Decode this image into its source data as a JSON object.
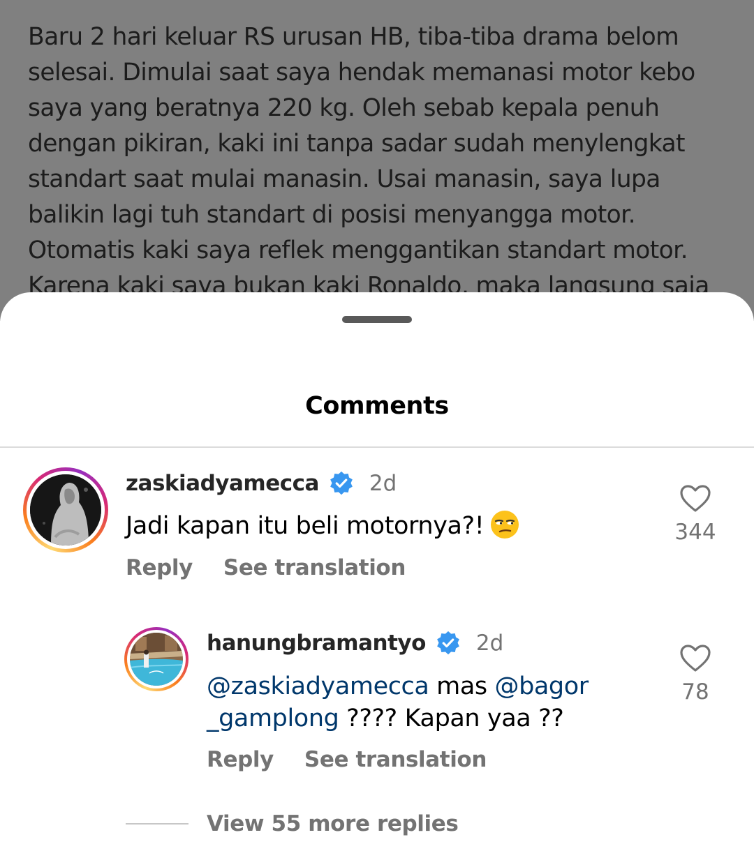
{
  "caption": {
    "lines": [
      "Baru 2 hari keluar RS urusan HB, tiba-tiba drama belom",
      "selesai. Dimulai saat saya hendak memanasi motor kebo",
      "saya yang beratnya 220 kg. Oleh sebab kepala penuh",
      "dengan pikiran, kaki ini tanpa sadar sudah menylengkat",
      "standart saat mulai manasin. Usai manasin, saya lupa",
      "balikin lagi tuh standart di posisi menyangga motor.",
      "Otomatis kaki saya reflek menggantikan standart motor.",
      "Karena kaki saya bukan kaki Ronaldo, maka langsung saja"
    ]
  },
  "sheet": {
    "title": "Comments"
  },
  "comments": [
    {
      "username": "zaskiadyamecca",
      "verified": true,
      "time": "2d",
      "text": "Jadi kapan itu beli motornya?!",
      "emoji": "unamused-face-icon",
      "reply_label": "Reply",
      "translate_label": "See translation",
      "likes": "344"
    },
    {
      "username": "hanungbramantyo",
      "verified": true,
      "time": "2d",
      "text_line1_mention1": "@zaskiadyamecca",
      "text_line1_mid": " mas ",
      "text_line1_mention2": "@bagor",
      "text_line2_mention": "_gamplong",
      "text_line2_rest": " ???? Kapan yaa ??",
      "reply_label": "Reply",
      "translate_label": "See translation",
      "likes": "78"
    }
  ],
  "view_more_replies": "View 55 more replies",
  "colors": {
    "backdrop": "#808080",
    "mention": "#00376b",
    "secondary_text": "#737373",
    "verified": "#3897f0"
  }
}
